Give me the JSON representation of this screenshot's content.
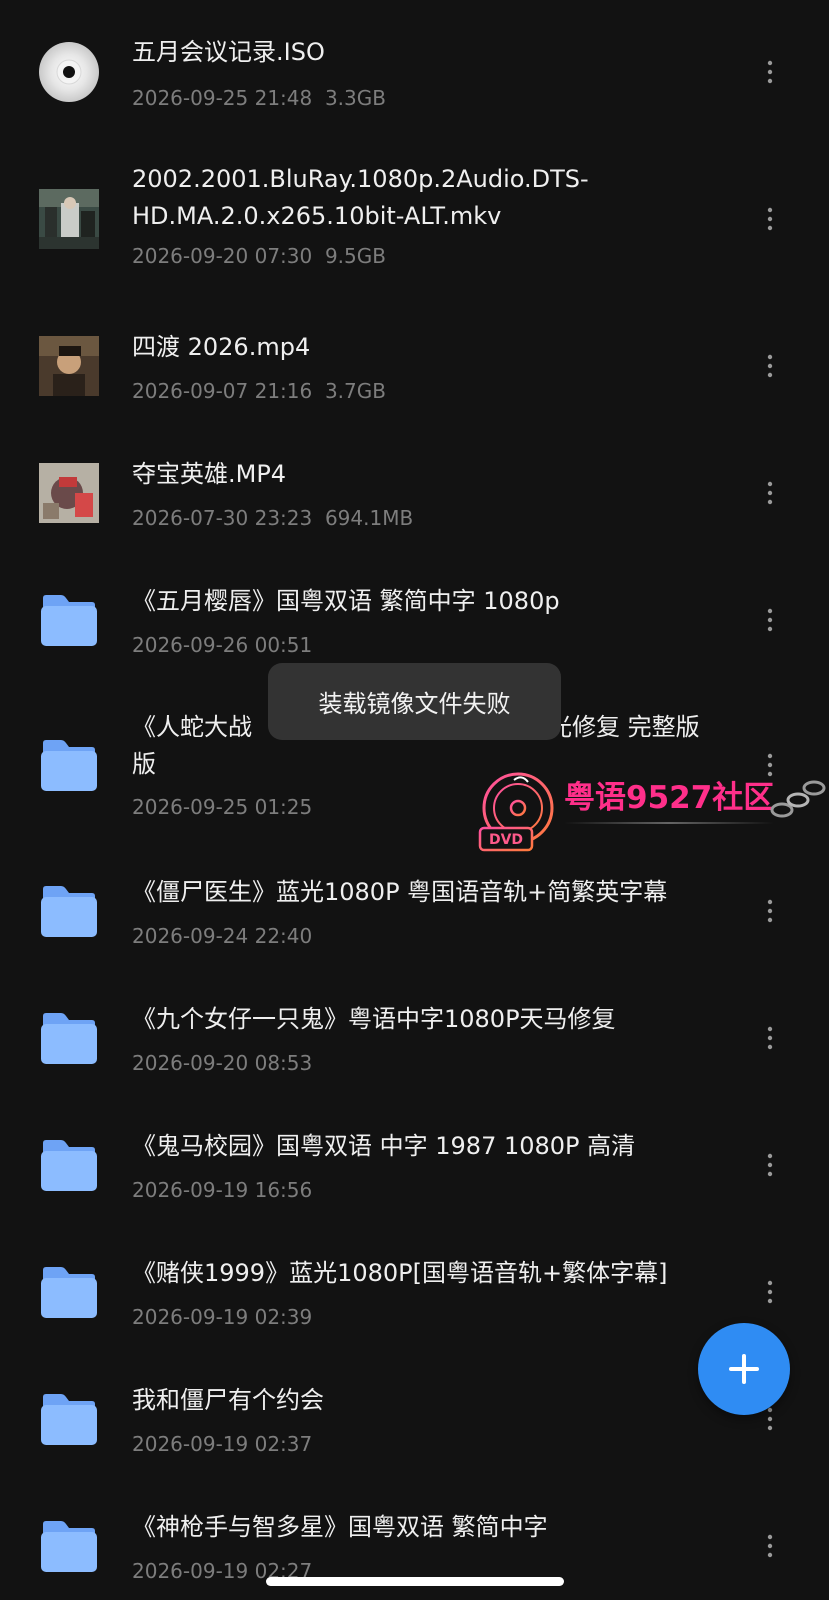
{
  "items": [
    {
      "icon": "disc-icon",
      "name": "五月会议记录.ISO",
      "date": "2026-09-25 21:48",
      "size": "3.3GB"
    },
    {
      "icon": "video-thumbnail",
      "name": "2002.2001.BluRay.1080p.2Audio.DTS-HD.MA.2.0.x265.10bit-ALT.mkv",
      "date": "2026-09-20 07:30",
      "size": "9.5GB"
    },
    {
      "icon": "video-thumbnail",
      "name": "四渡 2026.mp4",
      "date": "2026-09-07 21:16",
      "size": "3.7GB"
    },
    {
      "icon": "video-thumbnail",
      "name": "夺宝英雄.MP4",
      "date": "2026-07-30 23:23",
      "size": "694.1MB"
    },
    {
      "icon": "folder-icon",
      "name": "《五月樱唇》国粤双语 繁简中字 1080p",
      "date": "2026-09-26 00:51",
      "size": ""
    },
    {
      "icon": "folder-icon",
      "name": "《人蛇大战",
      "name_tail": "光修复 完整版",
      "date": "2026-09-25 01:25",
      "size": ""
    },
    {
      "icon": "folder-icon",
      "name": "《僵尸医生》蓝光1080P 粤国语音轨+简繁英字幕",
      "date": "2026-09-24 22:40",
      "size": ""
    },
    {
      "icon": "folder-icon",
      "name": "《九个女仔一只鬼》粤语中字1080P天马修复",
      "date": "2026-09-20 08:53",
      "size": ""
    },
    {
      "icon": "folder-icon",
      "name": "《鬼马校园》国粤双语 中字 1987 1080P 高清",
      "date": "2026-09-19 16:56",
      "size": ""
    },
    {
      "icon": "folder-icon",
      "name": "《赌侠1999》蓝光1080P[国粤语音轨+繁体字幕]",
      "date": "2026-09-19 02:39",
      "size": ""
    },
    {
      "icon": "folder-icon",
      "name": "我和僵尸有个约会",
      "date": "2026-09-19 02:37",
      "size": ""
    },
    {
      "icon": "folder-icon",
      "name": "《神枪手与智多星》国粤双语 繁简中字",
      "date": "2026-09-19 02:27",
      "size": ""
    }
  ],
  "toast": {
    "message": "装载镜像文件失败"
  },
  "watermark": {
    "text": "粤语9527社区",
    "badge": "DVD"
  },
  "fab": {
    "icon": "plus-icon"
  },
  "colors": {
    "background": "#121212",
    "folder": "#7fb2ff",
    "fab": "#2f8cf3",
    "secondary_text": "#7d7d7d",
    "watermark": "#ff2f8a"
  }
}
